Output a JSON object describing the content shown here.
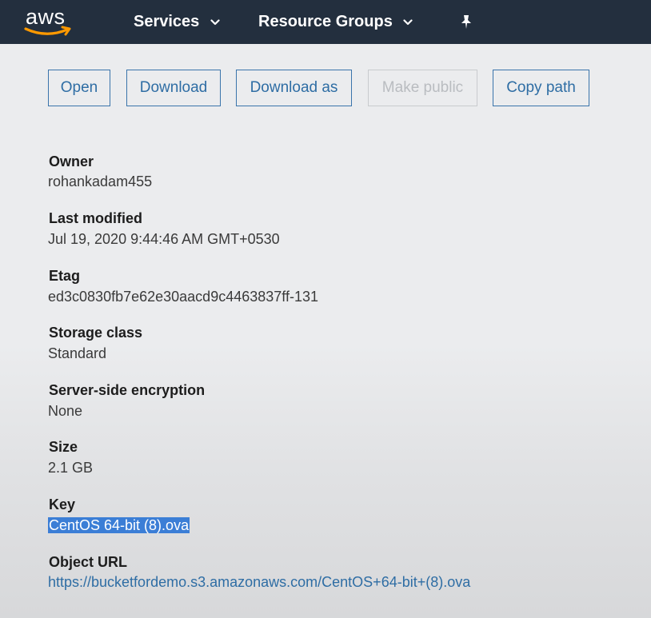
{
  "header": {
    "logo_text": "aws",
    "nav": {
      "services": "Services",
      "resource_groups": "Resource Groups"
    }
  },
  "toolbar": {
    "open": "Open",
    "download": "Download",
    "download_as": "Download as",
    "make_public": "Make public",
    "copy_path": "Copy path"
  },
  "properties": {
    "owner": {
      "label": "Owner",
      "value": "rohankadam455"
    },
    "last_modified": {
      "label": "Last modified",
      "value": "Jul 19, 2020 9:44:46 AM GMT+0530"
    },
    "etag": {
      "label": "Etag",
      "value": "ed3c0830fb7e62e30aacd9c4463837ff-131"
    },
    "storage_class": {
      "label": "Storage class",
      "value": "Standard"
    },
    "encryption": {
      "label": "Server-side encryption",
      "value": "None"
    },
    "size": {
      "label": "Size",
      "value": "2.1 GB"
    },
    "key": {
      "label": "Key",
      "value": "CentOS 64-bit (8).ova"
    },
    "object_url": {
      "label": "Object URL",
      "value": "https://bucketfordemo.s3.amazonaws.com/CentOS+64-bit+(8).ova"
    }
  },
  "colors": {
    "nav_bg": "#232f3e",
    "link": "#2e6da4",
    "selection": "#3b7ed6",
    "disabled": "#b9bcc0"
  }
}
